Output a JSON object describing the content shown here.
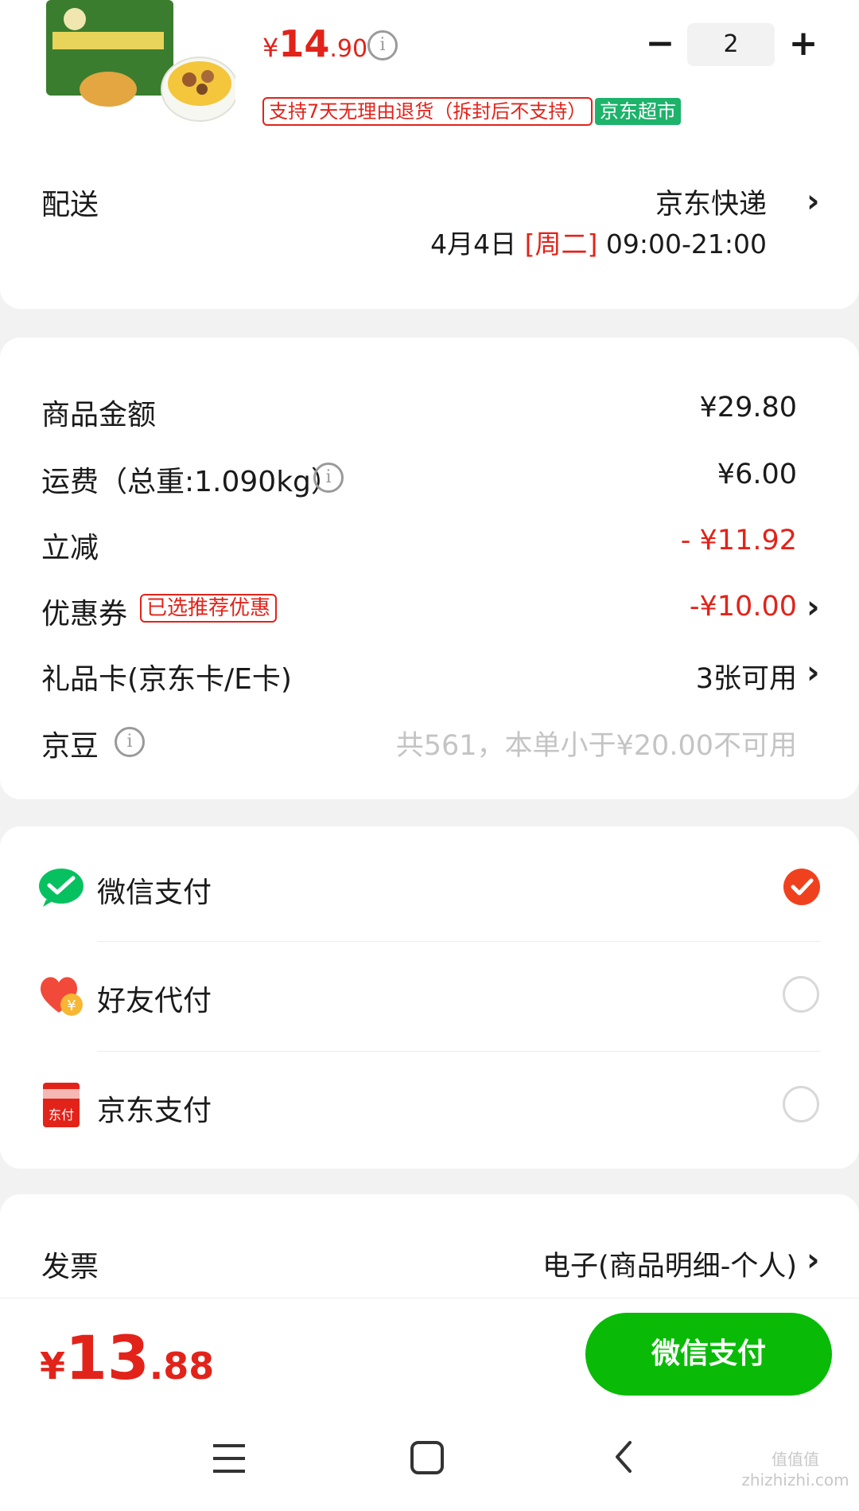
{
  "product": {
    "image_alt": "小鸡炖蘑菇面",
    "price_currency": "¥",
    "price_int": "14",
    "price_dec": ".90",
    "quantity": "2",
    "tag_return": "支持7天无理由退货（拆封后不支持）",
    "tag_store": "京东超市"
  },
  "delivery": {
    "label": "配送",
    "carrier": "京东快递",
    "date": "4月4日",
    "weekday": "[周二]",
    "time": "09:00-21:00"
  },
  "summary": {
    "goods_label": "商品金额",
    "goods_value": "¥29.80",
    "shipping_label": "运费（总重:1.090kg）",
    "shipping_value": "¥6.00",
    "discount_label": "立减",
    "discount_value": "- ¥11.92",
    "coupon_label": "优惠券",
    "coupon_tag": "已选推荐优惠",
    "coupon_value": "-¥10.00",
    "giftcard_label": "礼品卡(京东卡/E卡)",
    "giftcard_value": "3张可用",
    "jingdou_label": "京豆",
    "jingdou_value": "共561，本单小于¥20.00不可用"
  },
  "payment": {
    "methods": [
      {
        "label": "微信支付",
        "selected": true
      },
      {
        "label": "好友代付",
        "selected": false
      },
      {
        "label": "京东支付",
        "selected": false
      }
    ],
    "jdpay_icon_text": "东付",
    "friend_icon_text": "¥"
  },
  "invoice": {
    "label": "发票",
    "value": "电子(商品明细-个人)"
  },
  "footer": {
    "total_currency": "¥",
    "total_int": "13",
    "total_dec": ".88",
    "pay_button": "微信支付"
  },
  "colors": {
    "accent_red": "#e2231a",
    "wechat_green": "#07c160",
    "store_green": "#1db36b"
  },
  "watermark": "值值值 zhizhizhi.com"
}
